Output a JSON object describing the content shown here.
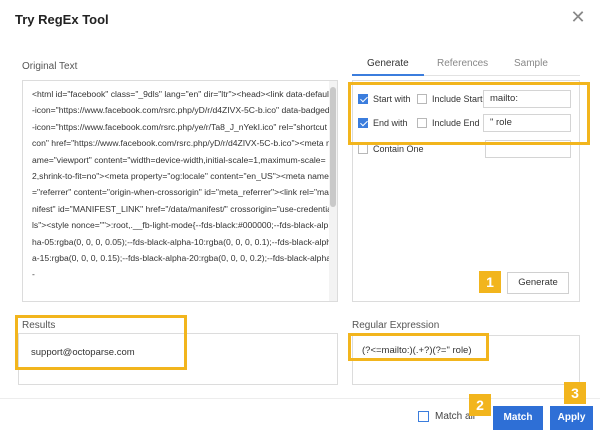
{
  "window": {
    "title": "Try RegEx Tool",
    "close_glyph": "✕"
  },
  "original": {
    "label": "Original Text",
    "text": "<html id=\"facebook\" class=\"_9dls\" lang=\"en\" dir=\"ltr\"><head><link data-default-icon=\"https://www.facebook.com/rsrc.php/yD/r/d4ZIVX-5C-b.ico\" data-badged-icon=\"https://www.facebook.com/rsrc.php/ye/r/Ta8_J_nYekI.ico\" rel=\"shortcut icon\" href=\"https://www.facebook.com/rsrc.php/yD/r/d4ZIVX-5C-b.ico\"><meta name=\"viewport\" content=\"width=device-width,initial-scale=1,maximum-scale=2,shrink-to-fit=no\"><meta property=\"og:locale\" content=\"en_US\"><meta name=\"referrer\" content=\"origin-when-crossorigin\" id=\"meta_referrer\"><link rel=\"manifest\" id=\"MANIFEST_LINK\" href=\"/data/manifest/\" crossorigin=\"use-credentials\"><style nonce=\"\">:root,.__fb-light-mode{--fds-black:#000000;--fds-black-alpha-05:rgba(0, 0, 0, 0.05);--fds-black-alpha-10:rgba(0, 0, 0, 0.1);--fds-black-alpha-15:rgba(0, 0, 0, 0.15);--fds-black-alpha-20:rgba(0, 0, 0, 0.2);--fds-black-alpha-"
  },
  "tabs": [
    {
      "label": "Generate",
      "active": true
    },
    {
      "label": "References",
      "active": false
    },
    {
      "label": "Sample",
      "active": false
    }
  ],
  "generate": {
    "start_with": {
      "label": "Start with",
      "checked": true,
      "value": "mailto:"
    },
    "include_start": {
      "label": "Include Start",
      "checked": false
    },
    "end_with": {
      "label": "End with",
      "checked": true,
      "value": "\" role"
    },
    "include_end": {
      "label": "Include End",
      "checked": false
    },
    "contain_one": {
      "label": "Contain One",
      "checked": false,
      "value": ""
    },
    "button_label": "Generate"
  },
  "results": {
    "label": "Results",
    "value": "support@octoparse.com"
  },
  "regex": {
    "label": "Regular Expression",
    "value": "(?<=mailto:)(.+?)(?=\" role)"
  },
  "footer": {
    "match_all": {
      "label": "Match all",
      "checked": false
    },
    "match_label": "Match",
    "apply_label": "Apply"
  },
  "annotations": {
    "badges": [
      "1",
      "2",
      "3"
    ],
    "color": "#f2b51d"
  },
  "colors": {
    "accent": "#2e6fd6",
    "highlight": "#f2b51d"
  }
}
